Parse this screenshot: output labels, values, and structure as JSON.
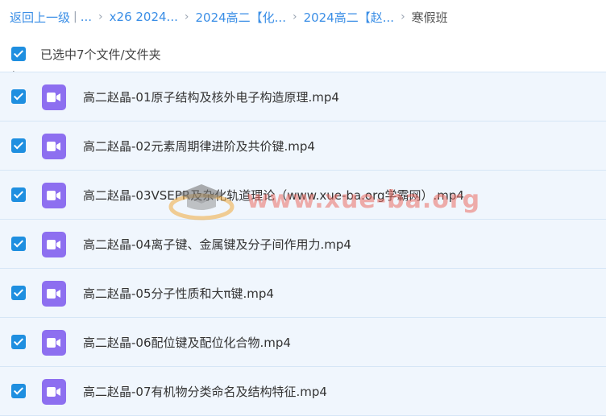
{
  "breadcrumb": {
    "back": "返回上一级",
    "separator": "|",
    "ellipsis": "...",
    "items": [
      "x26 2024...",
      "2024高二【化...",
      "2024高二【赵..."
    ],
    "current": "寒假班",
    "chevron": "›"
  },
  "selection": {
    "label": "已选中7个文件/文件夹",
    "checked": true
  },
  "files": [
    {
      "name": "高二赵晶-01原子结构及核外电子构造原理.mp4",
      "type": "video-icon",
      "checked": true
    },
    {
      "name": "高二赵晶-02元素周期律进阶及共价键.mp4",
      "type": "video-icon",
      "checked": true
    },
    {
      "name": "高二赵晶-03VSEPR及杂化轨道理论（www.xue-ba.org学霸网）.mp4",
      "type": "video-icon",
      "checked": true
    },
    {
      "name": "高二赵晶-04离子键、金属键及分子间作用力.mp4",
      "type": "video-icon",
      "checked": true
    },
    {
      "name": "高二赵晶-05分子性质和大π键.mp4",
      "type": "video-icon",
      "checked": true
    },
    {
      "name": "高二赵晶-06配位键及配位化合物.mp4",
      "type": "video-icon",
      "checked": true
    },
    {
      "name": "高二赵晶-07有机物分类命名及结构特征.mp4",
      "type": "video-icon",
      "checked": true
    }
  ],
  "watermark": {
    "text": "www.xue-ba.org",
    "icon": "graduation-cap-icon"
  },
  "colors": {
    "link": "#3a8ee6",
    "checkbox": "#1f8fe0",
    "video_icon": "#8d6ff0",
    "row_bg": "#f0f6fd"
  }
}
